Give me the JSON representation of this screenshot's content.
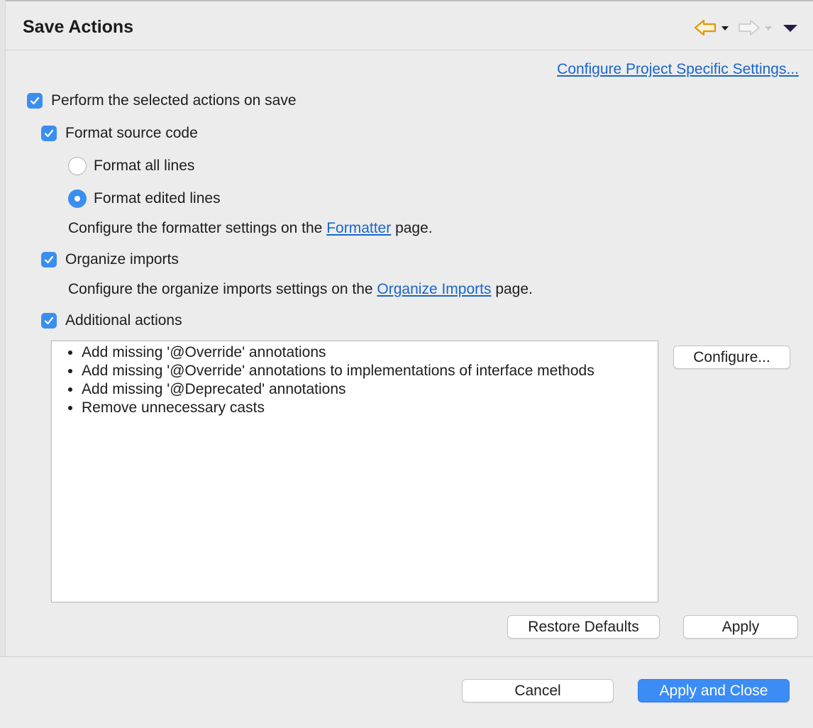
{
  "header": {
    "title": "Save Actions",
    "back_icon": "back-arrow-icon",
    "forward_icon": "forward-arrow-icon",
    "menu_icon": "view-menu-icon"
  },
  "project_settings_link": "Configure Project Specific Settings...",
  "perform_on_save": {
    "label": "Perform the selected actions on save",
    "checked": true
  },
  "format_source": {
    "label": "Format source code",
    "checked": true,
    "options": [
      {
        "label": "Format all lines",
        "selected": false
      },
      {
        "label": "Format edited lines",
        "selected": true
      }
    ],
    "config_prefix": "Configure the formatter settings on the",
    "config_link": "Formatter",
    "config_suffix": "page."
  },
  "organize_imports": {
    "label": "Organize imports",
    "checked": true,
    "config_prefix": "Configure the organize imports settings on the",
    "config_link": "Organize Imports",
    "config_suffix": "page."
  },
  "additional_actions": {
    "label": "Additional actions",
    "checked": true,
    "items": [
      "Add missing '@Override' annotations",
      "Add missing '@Override' annotations to implementations of interface methods",
      "Add missing '@Deprecated' annotations",
      "Remove unnecessary casts"
    ],
    "configure_label": "Configure..."
  },
  "buttons": {
    "restore_defaults": "Restore Defaults",
    "apply": "Apply",
    "cancel": "Cancel",
    "apply_and_close": "Apply and Close"
  },
  "colors": {
    "accent": "#3a8ef0",
    "link": "#1a66cc",
    "back_arrow": "#e8a31a"
  }
}
